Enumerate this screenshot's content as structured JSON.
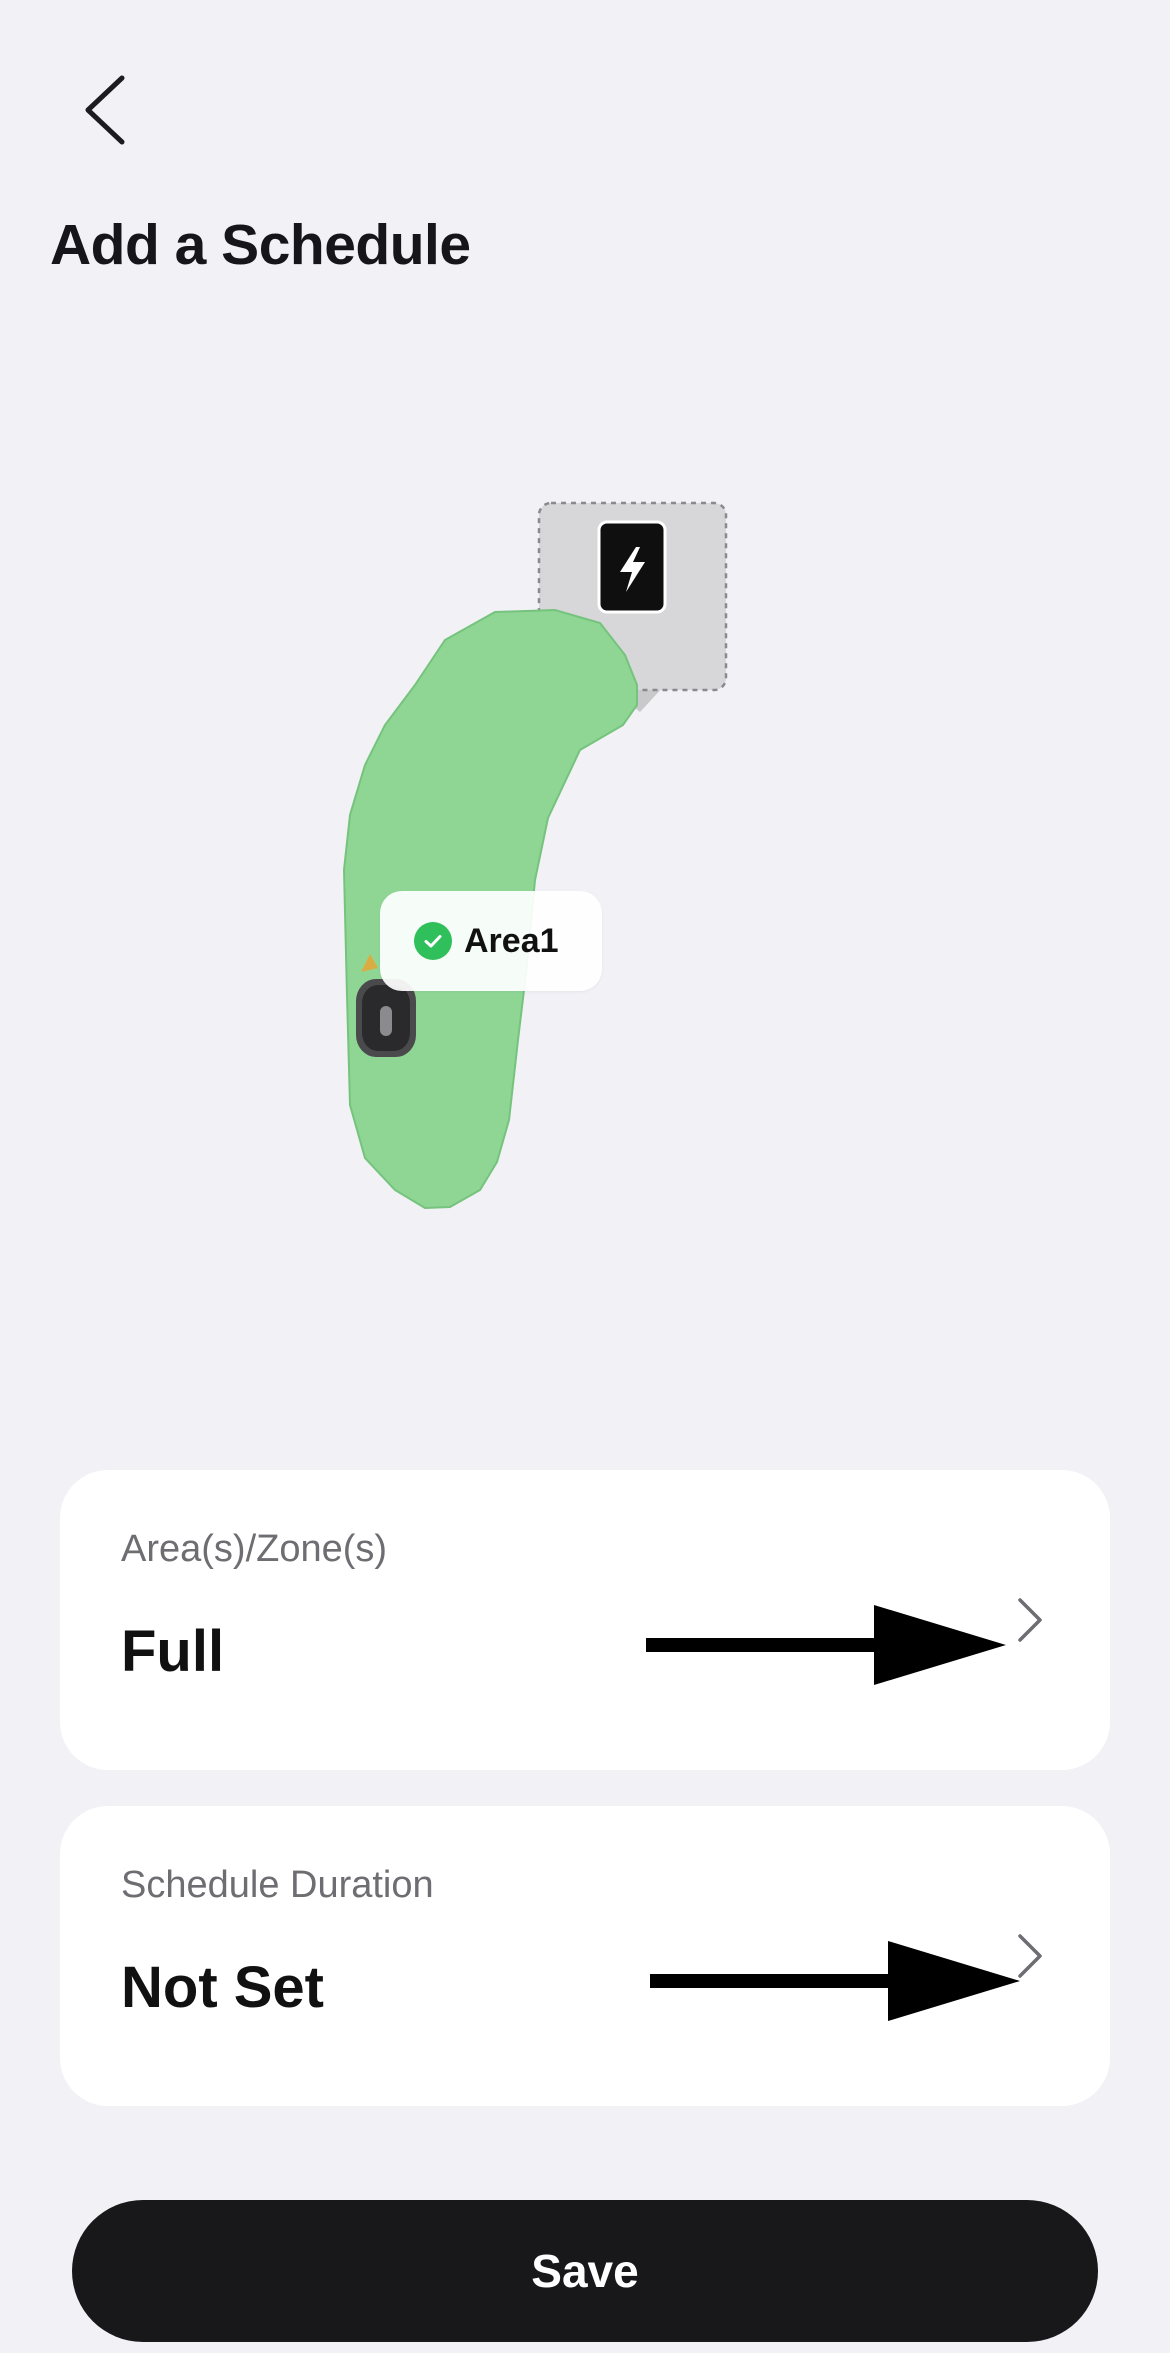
{
  "header": {
    "back_icon": "chevron-left-icon",
    "title": "Add a Schedule"
  },
  "map": {
    "area_label": "Area1",
    "area_color": "#8fd695",
    "charging_station_icon": "lightning-bolt-icon",
    "mower_icon": "robot-mower-icon",
    "selected_icon": "check-circle-icon",
    "selected_color": "#2fbf5b"
  },
  "settings": {
    "area_zone": {
      "label": "Area(s)/Zone(s)",
      "value": "Full",
      "icon": "chevron-right-icon"
    },
    "schedule_duration": {
      "label": "Schedule Duration",
      "value": "Not Set",
      "icon": "chevron-right-icon"
    }
  },
  "actions": {
    "save_label": "Save"
  }
}
